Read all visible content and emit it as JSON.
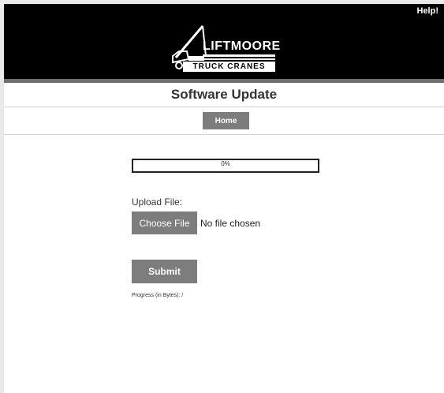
{
  "header": {
    "help_label": "Help!",
    "logo_main": "LIFTMOORE",
    "logo_sub": "TRUCK CRANES"
  },
  "page_title": "Software Update",
  "nav": {
    "home_label": "Home"
  },
  "progress": {
    "text": "0%",
    "value": 0
  },
  "upload": {
    "label": "Upload File:",
    "choose_label": "Choose File",
    "file_status": "No file chosen"
  },
  "submit_label": "Submit",
  "bytes_progress": "Progress (in Bytes): /",
  "colors": {
    "header_bg": "#000000",
    "button_bg": "#7d7d7d",
    "button_text": "#ffffff"
  }
}
